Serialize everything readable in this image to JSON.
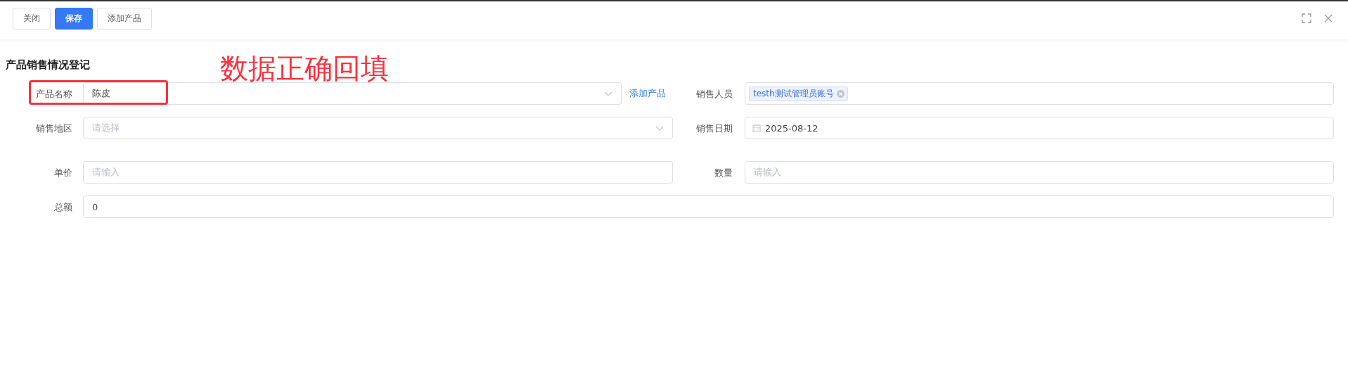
{
  "toolbar": {
    "buttons": [
      {
        "label": "关闭",
        "primary": false
      },
      {
        "label": "保存",
        "primary": true
      },
      {
        "label": "添加产品",
        "primary": false
      }
    ]
  },
  "section_title": "产品销售情况登记",
  "annotation": "数据正确回填",
  "rows": [
    [
      {
        "label": "产品名称",
        "kind": "select",
        "value": "陈皮",
        "action": "添加产品",
        "highlighted": true
      },
      {
        "label": "销售人员",
        "kind": "tags",
        "tags": [
          "testh测试管理员账号"
        ]
      }
    ],
    [
      {
        "label": "销售地区",
        "kind": "select",
        "placeholder": "请选择"
      },
      {
        "label": "销售日期",
        "kind": "date",
        "value": "2025-08-12"
      }
    ],
    [
      {
        "label": "单价",
        "kind": "input",
        "placeholder": "请输入"
      },
      {
        "label": "数量",
        "kind": "input",
        "placeholder": "请输入"
      }
    ],
    [
      {
        "label": "总额",
        "kind": "input",
        "value": "0"
      }
    ]
  ]
}
